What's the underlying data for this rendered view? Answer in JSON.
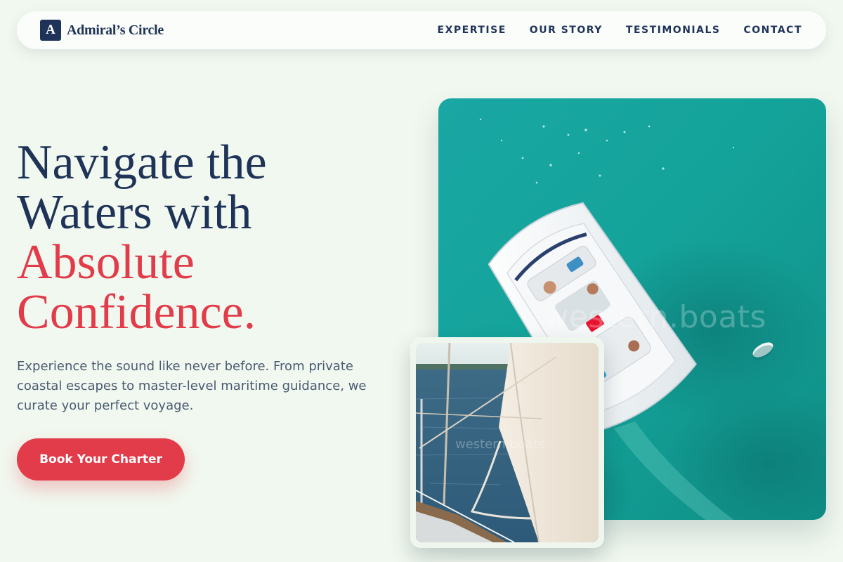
{
  "brand": {
    "mark": "A",
    "name": "Admiral’s Circle",
    "colors": {
      "navy": "#1f3358",
      "accent": "#e23c4b",
      "background": "#f1f8ef"
    }
  },
  "nav": {
    "items": [
      {
        "label": "EXPERTISE"
      },
      {
        "label": "OUR STORY"
      },
      {
        "label": "TESTIMONIALS"
      },
      {
        "label": "CONTACT"
      }
    ]
  },
  "hero": {
    "headline": {
      "line1": "Navigate the",
      "line2": "Waters with",
      "accent_line1": "Absolute",
      "accent_line2": "Confidence."
    },
    "description": "Experience the sound like never before. From private coastal escapes to master-level maritime guidance, we curate your perfect voyage.",
    "cta_label": "Book Your Charter"
  },
  "images": {
    "main": {
      "subject": "aerial-motorboat-turquoise-water",
      "watermark": "western.boats"
    },
    "secondary": {
      "subject": "sailboat-rigging-and-sail",
      "watermark": "western.boats"
    }
  }
}
